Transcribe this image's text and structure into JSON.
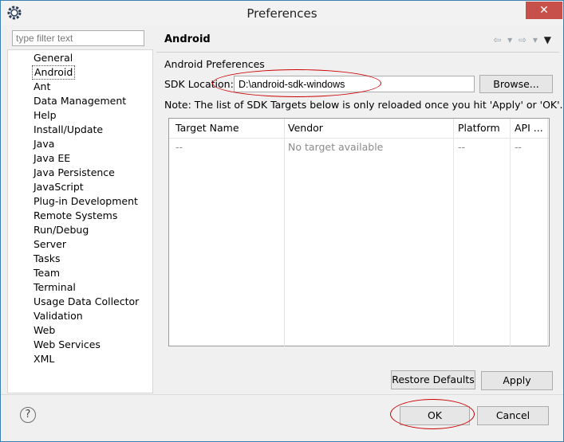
{
  "window": {
    "title": "Preferences",
    "close_glyph": "✕"
  },
  "filter": {
    "placeholder": "type filter text"
  },
  "tree": {
    "items": [
      "General",
      "Android",
      "Ant",
      "Data Management",
      "Help",
      "Install/Update",
      "Java",
      "Java EE",
      "Java Persistence",
      "JavaScript",
      "Plug-in Development",
      "Remote Systems",
      "Run/Debug",
      "Server",
      "Tasks",
      "Team",
      "Terminal",
      "Usage Data Collector",
      "Validation",
      "Web",
      "Web Services",
      "XML"
    ],
    "selected": "Android"
  },
  "page": {
    "title": "Android",
    "nav_icons": {
      "back": "⇦",
      "back_menu": "▾",
      "forward": "⇨",
      "forward_menu": "▾",
      "view_menu": "▼"
    },
    "section_label": "Android Preferences",
    "sdk_label": "SDK Location:",
    "sdk_value": "D:\\android-sdk-windows",
    "browse_label": "Browse...",
    "note": "Note: The list of SDK Targets below is only reloaded once you hit 'Apply' or 'OK'.",
    "table": {
      "headers": [
        "Target Name",
        "Vendor",
        "Platform",
        "API ..."
      ],
      "row": [
        "--",
        "No target available",
        "--",
        "--"
      ]
    },
    "restore_label": "Restore Defaults",
    "apply_label": "Apply"
  },
  "footer": {
    "help_glyph": "?",
    "ok_label": "OK",
    "cancel_label": "Cancel"
  },
  "colors": {
    "annotation": "#cc0000",
    "close_button": "#c7504a"
  }
}
